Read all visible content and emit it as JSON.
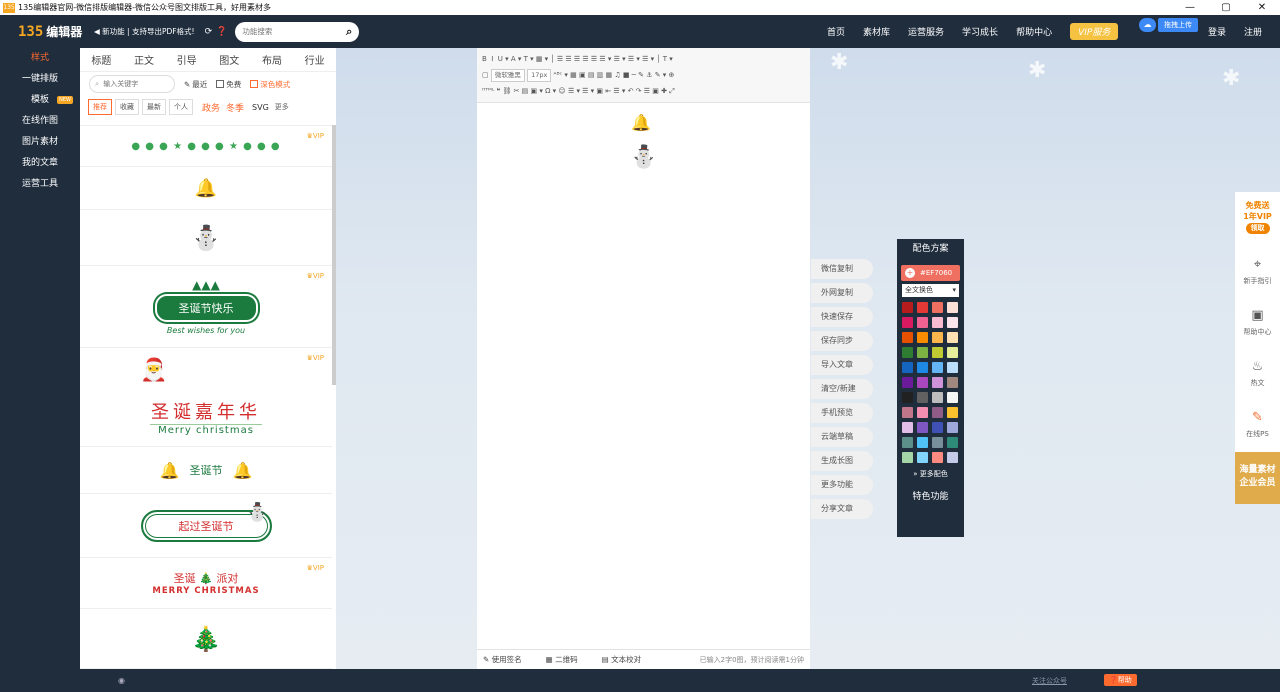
{
  "window": {
    "title": "135编辑器官网-微信排版编辑器-微信公众号图文排版工具，好用素材多",
    "icon_text": "135",
    "controls": [
      "—",
      "▢",
      "✕"
    ]
  },
  "header": {
    "logo_num": "135",
    "logo_text": "编辑器",
    "notice": "◀ 新功能 | 支持导出PDF格式!",
    "icons": [
      "⟳",
      "❓"
    ],
    "search_placeholder": "功能搜索",
    "nav": [
      "首页",
      "素材库",
      "运营服务",
      "学习成长",
      "帮助中心"
    ],
    "vip": "VIP服务",
    "upload_text": "拖拽上传",
    "login": "登录",
    "register": "注册"
  },
  "sidebar": {
    "items": [
      "样式",
      "一键排版",
      "模板",
      "在线作图",
      "图片素材",
      "我的文章",
      "运营工具"
    ],
    "new_badge": "NEW"
  },
  "panel": {
    "tabs": [
      "标题",
      "正文",
      "引导",
      "图文",
      "布局",
      "行业"
    ],
    "search_placeholder": "输入关键字",
    "recent": "最近",
    "free": "免费",
    "dark": "深色模式",
    "filters": [
      "推荐",
      "收藏",
      "最新",
      "个人"
    ],
    "tags": [
      "政务",
      "冬季"
    ],
    "svg": "SVG",
    "more": "更多",
    "vip_label": "VIP",
    "items": [
      {
        "vip": true,
        "text": "● ● ● ★ ● ● ● ★ ● ● ●"
      },
      {
        "vip": false,
        "text": "🔔"
      },
      {
        "vip": false,
        "text": "⛄"
      },
      {
        "vip": true,
        "title": "圣诞节快乐",
        "sub": "Best wishes for you"
      },
      {
        "vip": true,
        "title": "圣诞嘉年华",
        "sub": "Merry christmas"
      },
      {
        "vip": false,
        "title": "圣诞节"
      },
      {
        "vip": false,
        "title": "起过圣诞节"
      },
      {
        "vip": true,
        "title": "圣诞 🎄 派对",
        "sub": "MERRY CHRISTMAS"
      },
      {
        "vip": false,
        "text": "🎄"
      }
    ]
  },
  "editor": {
    "font_family": "微软雅黑",
    "font_size": "17px",
    "footer": [
      "使用签名",
      "二维码",
      "文本校对"
    ],
    "word_count": "已输入2字0图，预计阅读需1分钟"
  },
  "actions": [
    "微信复制",
    "外网复制",
    "快速保存",
    "保存同步",
    "导入文章",
    "清空/新建",
    "手机预览",
    "云端草稿",
    "生成长图",
    "更多功能",
    "分享文章"
  ],
  "scheme": {
    "title": "配色方案",
    "color_value": "#EF7060",
    "scope": "全文换色",
    "swatches": [
      "#b71c1c",
      "#e53935",
      "#ef7060",
      "#fde0d8",
      "#d81b60",
      "#f06292",
      "#f8bbd0",
      "#fce4ec",
      "#e65100",
      "#fb8c00",
      "#ffb74d",
      "#ffe0b2",
      "#2e7d32",
      "#7cb342",
      "#c0ca33",
      "#e6ee9c",
      "#1565c0",
      "#1e88e5",
      "#64b5f6",
      "#bbdefb",
      "#6a1b9a",
      "#ab47bc",
      "#ce93d8",
      "#a1887f",
      "#212121",
      "#616161",
      "#bdbdbd",
      "#f5f5f5",
      "#c2768a",
      "#f48fb1",
      "#8e5c86",
      "#fbc02d",
      "#e1bee7",
      "#7e57c2",
      "#3f51b5",
      "#9fa8da",
      "#5c8f8a",
      "#4fc3f7",
      "#78909c",
      "#2e8b7a",
      "#a5d6a7",
      "#81d4fa",
      "#ff8a80",
      "#c5cae9"
    ],
    "more": "更多配色",
    "feature": "特色功能"
  },
  "rightbar": {
    "promo": [
      "免费送",
      "1年VIP",
      "领取"
    ],
    "items": [
      {
        "icon": "⌖",
        "label": "新手指引"
      },
      {
        "icon": "▣",
        "label": "帮助中心"
      },
      {
        "icon": "♨",
        "label": "热文"
      },
      {
        "icon": "✎",
        "label": "在线PS"
      }
    ],
    "enterprise": [
      "海量素材",
      "企业会员"
    ]
  },
  "statusbar": {
    "icon": "◉",
    "follow": "关注公众号",
    "help": "❓帮助"
  }
}
